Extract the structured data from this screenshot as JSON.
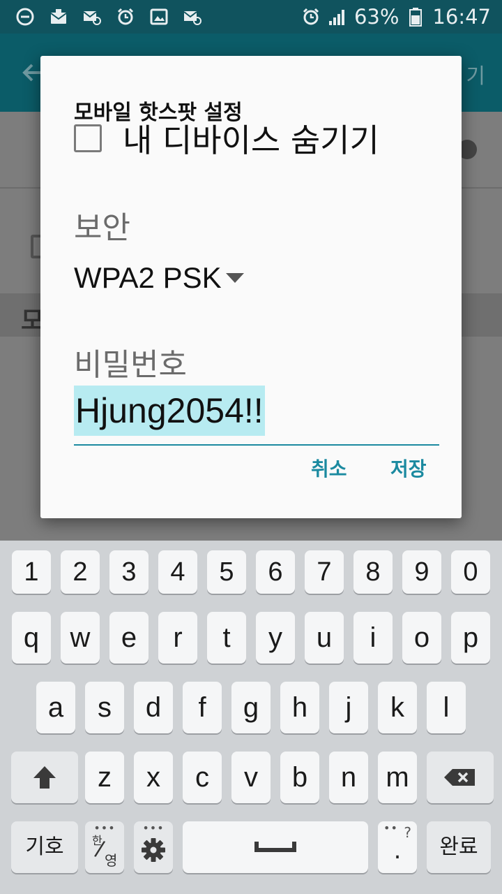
{
  "status_bar": {
    "battery_percent": "63%",
    "time": "16:47",
    "icons": [
      "do-not-disturb-icon",
      "mail-icon",
      "email-icon",
      "alarm-icon",
      "image-icon",
      "email-icon",
      "alarm-icon",
      "signal-icon",
      "battery-icon"
    ]
  },
  "background": {
    "appbar_right_text": "기",
    "band_text": "모"
  },
  "dialog": {
    "title": "모바일 핫스팟 설정",
    "hide_device_label": "내 디바이스 숨기기",
    "hide_device_checked": false,
    "security_label": "보안",
    "security_value": "WPA2 PSK",
    "password_label": "비밀번호",
    "password_value": "Hjung2054!!",
    "cancel_label": "취소",
    "save_label": "저장"
  },
  "keyboard": {
    "numbers": [
      "1",
      "2",
      "3",
      "4",
      "5",
      "6",
      "7",
      "8",
      "9",
      "0"
    ],
    "row1": [
      "q",
      "w",
      "e",
      "r",
      "t",
      "y",
      "u",
      "i",
      "o",
      "p"
    ],
    "row2": [
      "a",
      "s",
      "d",
      "f",
      "g",
      "h",
      "j",
      "k",
      "l"
    ],
    "row3": [
      "z",
      "x",
      "c",
      "v",
      "b",
      "n",
      "m"
    ],
    "symbols_label": "기호",
    "lang_top": "한",
    "lang_bottom": "영",
    "punct_hint": "?",
    "punct_label": ".",
    "done_label": "완료"
  },
  "colors": {
    "accent": "#1b8aa0",
    "status_bar": "#10535e",
    "selection": "#b7ebf1"
  }
}
